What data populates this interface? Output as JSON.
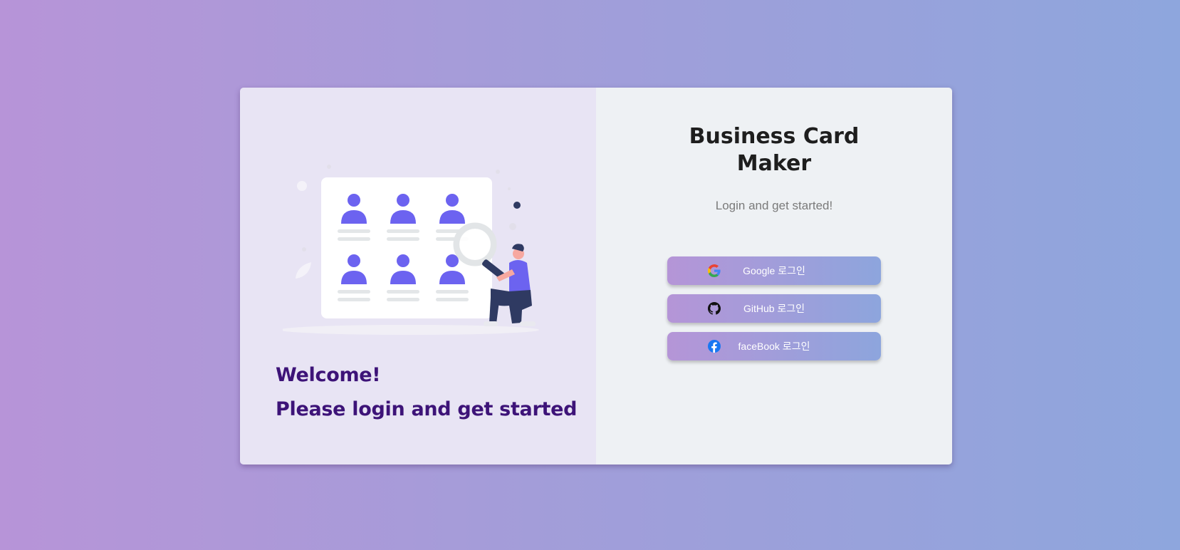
{
  "left_panel": {
    "welcome": "Welcome!",
    "message": "Please login and get started"
  },
  "right_panel": {
    "title_line1": "Business Card",
    "title_line2": "Maker",
    "subtitle": "Login and get started!"
  },
  "login_buttons": [
    {
      "label": "Google 로그인",
      "icon": "google-icon"
    },
    {
      "label": "GitHub 로그인",
      "icon": "github-icon"
    },
    {
      "label": "faceBook 로그인",
      "icon": "facebook-icon"
    }
  ],
  "colors": {
    "accent_text": "#3d1378",
    "button_gradient_start": "#b595d7",
    "button_gradient_end": "#8da5dd",
    "person_icon": "#6c63f0"
  }
}
